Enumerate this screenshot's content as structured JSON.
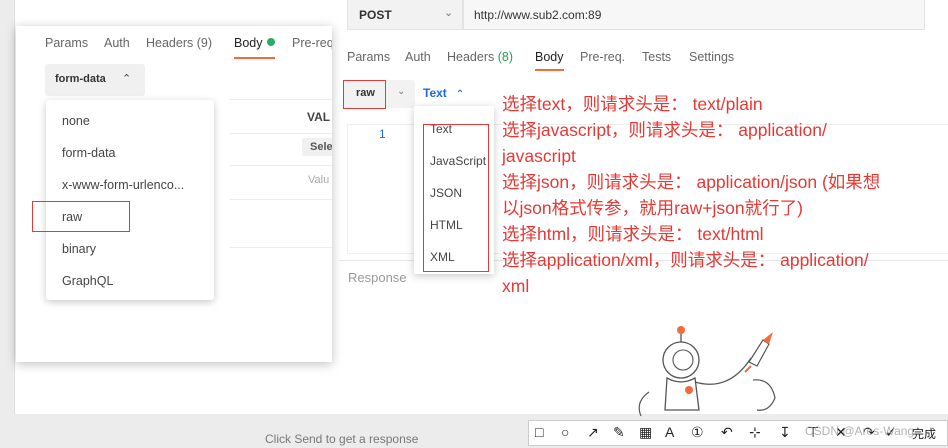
{
  "right_app": {
    "method": "POST",
    "url": "http://www.sub2.com:89",
    "tabs": [
      {
        "label": "Params"
      },
      {
        "label": "Auth"
      },
      {
        "label": "Headers",
        "count": "(8)"
      },
      {
        "label": "Body"
      },
      {
        "label": "Pre-req."
      },
      {
        "label": "Tests"
      },
      {
        "label": "Settings"
      }
    ],
    "body_mode": "raw",
    "raw_type": "Text",
    "editor_line_number": "1",
    "response_label": "Response",
    "bottom_hint": "Click Send to get a response"
  },
  "left_window": {
    "tabs": [
      {
        "label": "Params"
      },
      {
        "label": "Auth"
      },
      {
        "label": "Headers",
        "count": "(9)"
      },
      {
        "label": "Body"
      },
      {
        "label": "Pre-req"
      }
    ],
    "body_mode": "form-data",
    "value_header": "VAL",
    "select_chip": "Sele",
    "value_placeholder": "Valu",
    "body_menu": [
      "none",
      "form-data",
      "x-www-form-urlenco...",
      "raw",
      "binary",
      "GraphQL"
    ]
  },
  "text_menu": [
    "Text",
    "JavaScript",
    "JSON",
    "HTML",
    "XML"
  ],
  "annotations": [
    "选择text，则请求头是： text/plain",
    "选择javascript，则请求头是： application/",
    "javascript",
    "选择json，则请求头是： application/json (如果想",
    "以json格式传参，就用raw+json就行了)",
    "选择html，则请求头是： text/html",
    "选择application/xml，则请求头是： application/",
    "xml"
  ],
  "toolbar": {
    "done_label": "完成",
    "icons": [
      "rect-icon",
      "circle-icon",
      "arrow-icon",
      "pen-icon",
      "mosaic-icon",
      "text-icon",
      "number-icon",
      "undo-icon",
      "redo-icon",
      "crop-icon",
      "download-icon",
      "pin-icon",
      "close-icon",
      "check-icon"
    ]
  },
  "watermark": "CSDN @Ares-Wang",
  "colors": {
    "accent_orange": "#f26b3a",
    "link_blue": "#1e6bd0",
    "annotation_red": "#e53935",
    "status_green": "#27ae60"
  }
}
